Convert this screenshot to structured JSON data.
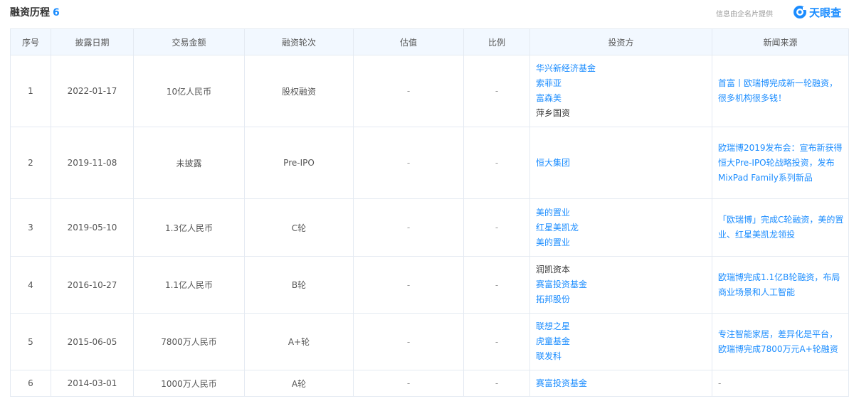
{
  "header": {
    "title": "融资历程",
    "count": "6",
    "info_note": "信息由企名片提供",
    "brand_name": "天眼查",
    "brand_color": "#1a8cff"
  },
  "table": {
    "columns": [
      "序号",
      "披露日期",
      "交易金额",
      "融资轮次",
      "估值",
      "比例",
      "投资方",
      "新闻来源"
    ],
    "rows": [
      {
        "index": "1",
        "date": "2022-01-17",
        "amount": "10亿人民币",
        "round": "股权融资",
        "valuation": "-",
        "ratio": "-",
        "investors": [
          {
            "name": "华兴新经济基金",
            "link": true
          },
          {
            "name": "索菲亚",
            "link": true
          },
          {
            "name": "富森美",
            "link": true
          },
          {
            "name": "萍乡国资",
            "link": false
          }
        ],
        "news": "首富丨欧瑞博完成新一轮融资，很多机构很多钱！"
      },
      {
        "index": "2",
        "date": "2019-11-08",
        "amount": "未披露",
        "round": "Pre-IPO",
        "valuation": "-",
        "ratio": "-",
        "investors": [
          {
            "name": "恒大集团",
            "link": true
          }
        ],
        "news": "欧瑞博2019发布会：宣布新获得恒大Pre-IPO轮战略投资，发布MixPad Family系列新品"
      },
      {
        "index": "3",
        "date": "2019-05-10",
        "amount": "1.3亿人民币",
        "round": "C轮",
        "valuation": "-",
        "ratio": "-",
        "investors": [
          {
            "name": "美的置业",
            "link": true
          },
          {
            "name": "红星美凯龙",
            "link": true
          },
          {
            "name": "美的置业",
            "link": true
          }
        ],
        "news": "「欧瑞博」完成C轮融资，美的置业、红星美凯龙领投"
      },
      {
        "index": "4",
        "date": "2016-10-27",
        "amount": "1.1亿人民币",
        "round": "B轮",
        "valuation": "-",
        "ratio": "-",
        "investors": [
          {
            "name": "润凯资本",
            "link": false
          },
          {
            "name": "赛富投资基金",
            "link": true
          },
          {
            "name": "拓邦股份",
            "link": true
          }
        ],
        "news": "欧瑞博完成1.1亿B轮融资，布局商业场景和人工智能"
      },
      {
        "index": "5",
        "date": "2015-06-05",
        "amount": "7800万人民币",
        "round": "A+轮",
        "valuation": "-",
        "ratio": "-",
        "investors": [
          {
            "name": "联想之星",
            "link": true
          },
          {
            "name": "虎童基金",
            "link": true
          },
          {
            "name": "联发科",
            "link": true
          }
        ],
        "news": "专注智能家居，差异化是平台，欧瑞博完成7800万元A+轮融资"
      },
      {
        "index": "6",
        "date": "2014-03-01",
        "amount": "1000万人民币",
        "round": "A轮",
        "valuation": "-",
        "ratio": "-",
        "investors": [
          {
            "name": "赛富投资基金",
            "link": true
          }
        ],
        "news": "-"
      }
    ]
  }
}
